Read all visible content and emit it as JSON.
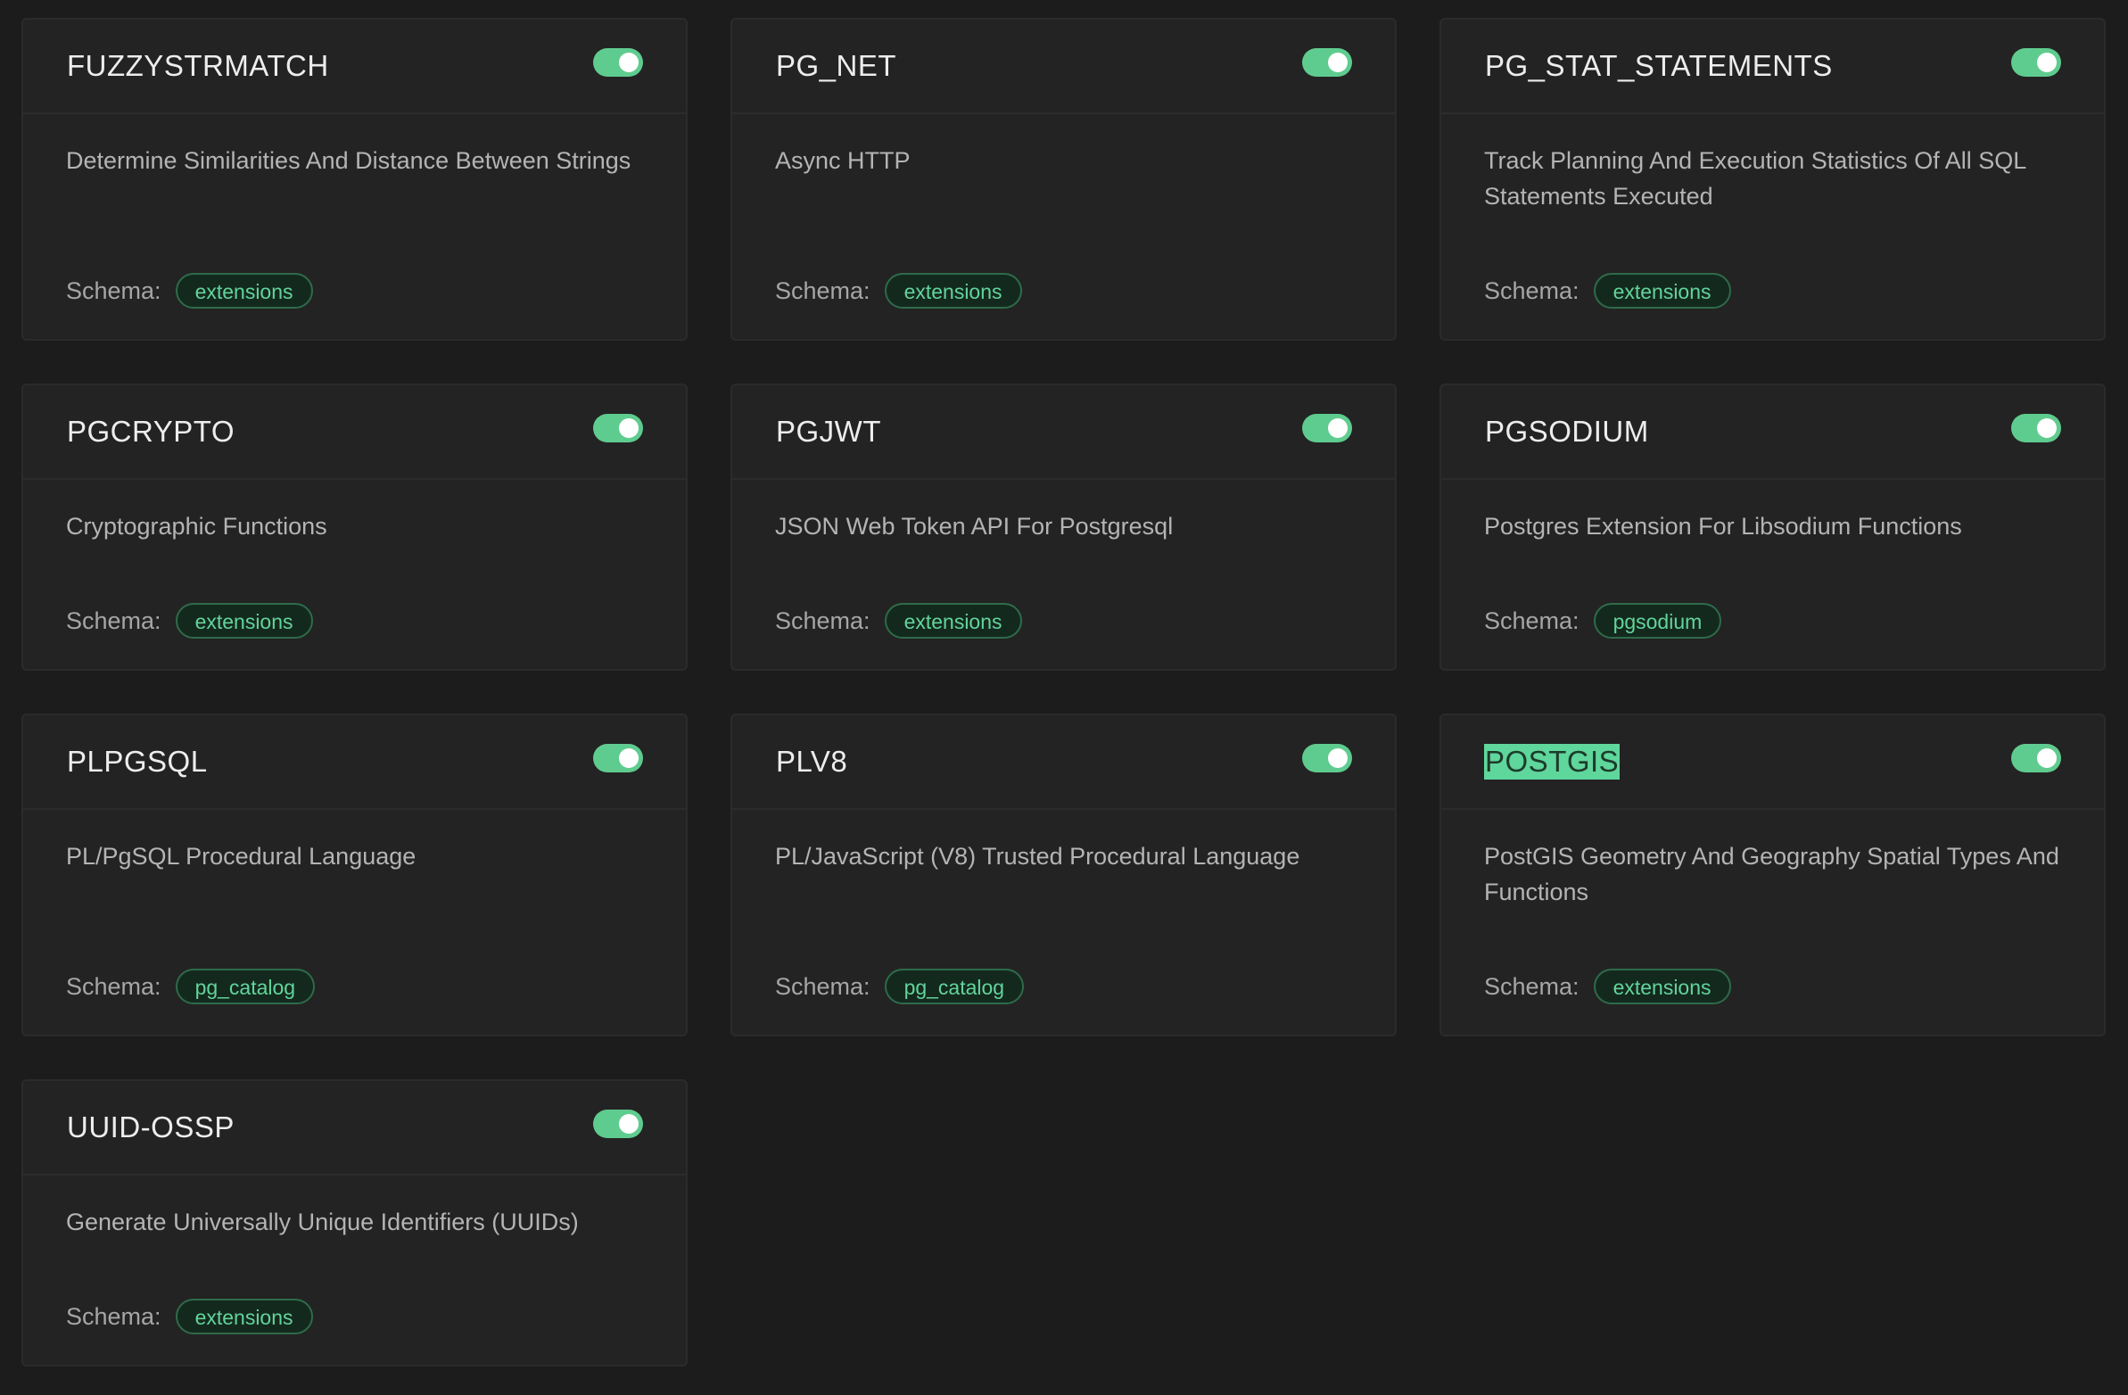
{
  "schema_label": "Schema:",
  "colors": {
    "background": "#1c1c1c",
    "card": "#232323",
    "toggle_on": "#5fcc8f",
    "badge_text": "#62d49b",
    "highlight": "#5fd69c"
  },
  "extensions": [
    {
      "name": "FUZZYSTRMATCH",
      "description": "Determine Similarities And Distance Between Strings",
      "schema": "extensions",
      "enabled": true
    },
    {
      "name": "PG_NET",
      "description": "Async HTTP",
      "schema": "extensions",
      "enabled": true
    },
    {
      "name": "PG_STAT_STATEMENTS",
      "description": "Track Planning And Execution Statistics Of All SQL Statements Executed",
      "schema": "extensions",
      "enabled": true
    },
    {
      "name": "PGCRYPTO",
      "description": "Cryptographic Functions",
      "schema": "extensions",
      "enabled": true
    },
    {
      "name": "PGJWT",
      "description": "JSON Web Token API For Postgresql",
      "schema": "extensions",
      "enabled": true
    },
    {
      "name": "PGSODIUM",
      "description": "Postgres Extension For Libsodium Functions",
      "schema": "pgsodium",
      "enabled": true
    },
    {
      "name": "PLPGSQL",
      "description": "PL/PgSQL Procedural Language",
      "schema": "pg_catalog",
      "enabled": true
    },
    {
      "name": "PLV8",
      "description": "PL/JavaScript (V8) Trusted Procedural Language",
      "schema": "pg_catalog",
      "enabled": true
    },
    {
      "name": "POSTGIS",
      "description": "PostGIS Geometry And Geography Spatial Types And Functions",
      "schema": "extensions",
      "enabled": true,
      "highlighted": true
    },
    {
      "name": "UUID-OSSP",
      "description": "Generate Universally Unique Identifiers (UUIDs)",
      "schema": "extensions",
      "enabled": true
    }
  ]
}
